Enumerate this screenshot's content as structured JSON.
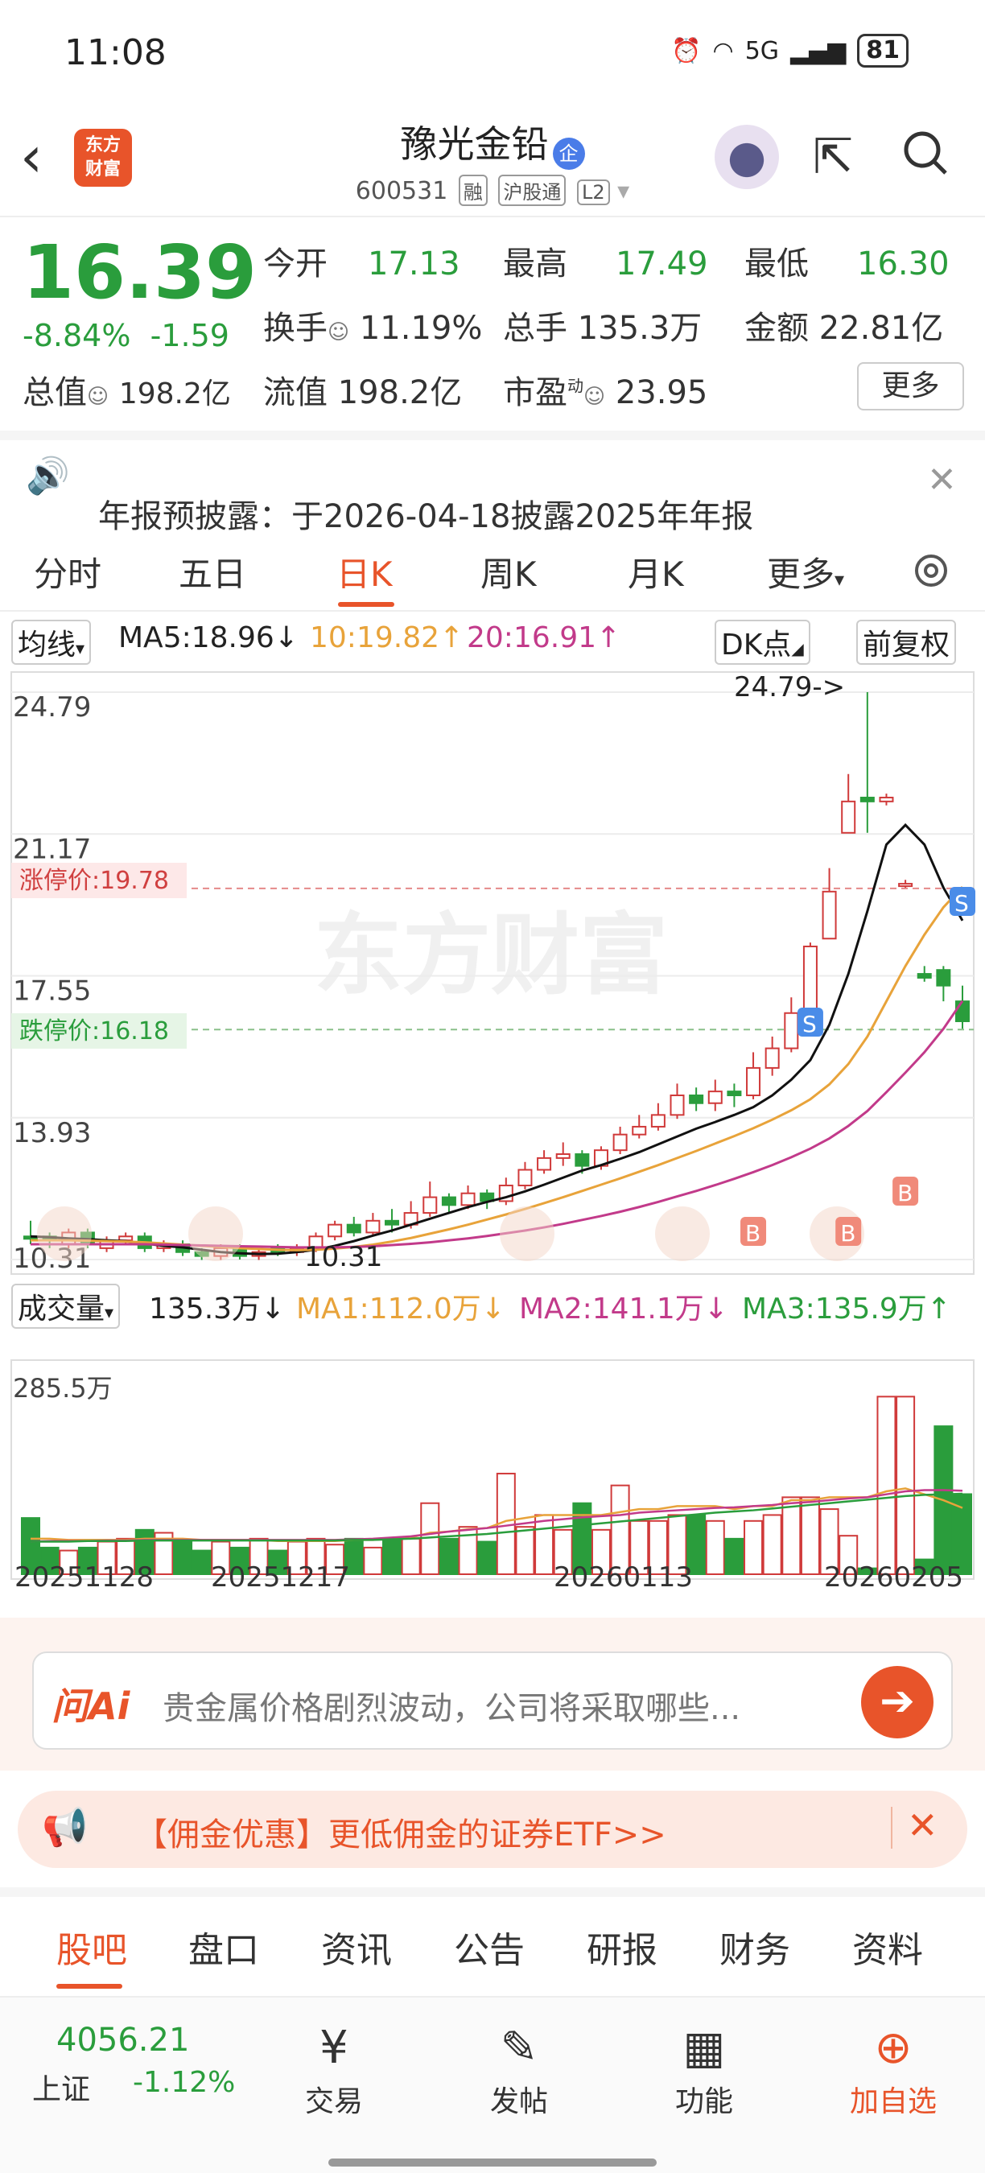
{
  "status_bar": {
    "time": "11:08",
    "battery": "81",
    "signal": "5G"
  },
  "header": {
    "name": "豫光金铅",
    "badge": "企",
    "code": "600531",
    "tags": [
      "融",
      "沪股通",
      "L2"
    ],
    "logo_text": [
      "东方",
      "财富"
    ]
  },
  "quote": {
    "price": "16.39",
    "pct": "-8.84%",
    "change": "-1.59",
    "open_label": "今开",
    "open": "17.13",
    "high_label": "最高",
    "high": "17.49",
    "low_label": "最低",
    "low": "16.30",
    "turnover_label": "换手",
    "turnover": "11.19%",
    "volume_label": "总手",
    "volume": "135.3万",
    "amount_label": "金额",
    "amount": "22.81亿",
    "mktcap_label": "总值",
    "mktcap": "198.2亿",
    "float_label": "流值",
    "float": "198.2亿",
    "pe_label": "市盈",
    "pe_sup": "动",
    "pe": "23.95",
    "more": "更多"
  },
  "notice": {
    "text": "年报预披露：于2026-04-18披露2025年年报"
  },
  "ktabs": [
    "分时",
    "五日",
    "日K",
    "周K",
    "月K",
    "更多"
  ],
  "ma": {
    "select": "均线",
    "ma5": "MA5:18.96↓",
    "ma10": "10:19.82↑",
    "ma20": "20:16.91↑",
    "dk": "DK点",
    "adjust": "前复权"
  },
  "kchart": {
    "y_labels": [
      "24.79",
      "21.17",
      "17.55",
      "13.93",
      "10.31"
    ],
    "limit_up": "涨停价:19.78",
    "limit_down": "跌停价:16.18",
    "max_note": "24.79->",
    "min_note": "10.31",
    "watermark": "东方财富",
    "signals": {
      "B": "B",
      "S": "S"
    }
  },
  "vol": {
    "select": "成交量",
    "vol": "135.3万↓",
    "ma1": "MA1:112.0万↓",
    "ma2": "MA2:141.1万↓",
    "ma3": "MA3:135.9万↑",
    "max": "285.5万"
  },
  "dates": [
    "20251128",
    "20251217",
    "20260113",
    "20260205"
  ],
  "chart_data": {
    "type": "candlestick",
    "ylim": [
      10.31,
      24.79
    ],
    "candles": [
      [
        10.9,
        10.85,
        11.3,
        10.7
      ],
      [
        10.9,
        10.8,
        11.0,
        10.6
      ],
      [
        10.7,
        11.0,
        11.1,
        10.6
      ],
      [
        11.0,
        10.7,
        11.1,
        10.6
      ],
      [
        10.6,
        10.8,
        10.9,
        10.5
      ],
      [
        10.8,
        10.9,
        11.0,
        10.7
      ],
      [
        10.9,
        10.6,
        11.0,
        10.5
      ],
      [
        10.6,
        10.7,
        10.8,
        10.5
      ],
      [
        10.7,
        10.5,
        10.8,
        10.4
      ],
      [
        10.5,
        10.4,
        10.6,
        10.3
      ],
      [
        10.4,
        10.6,
        10.7,
        10.3
      ],
      [
        10.6,
        10.4,
        10.7,
        10.31
      ],
      [
        10.4,
        10.5,
        10.6,
        10.3
      ],
      [
        10.6,
        10.5,
        10.7,
        10.4
      ],
      [
        10.5,
        10.6,
        10.7,
        10.4
      ],
      [
        10.6,
        10.9,
        11.0,
        10.5
      ],
      [
        10.9,
        11.2,
        11.3,
        10.8
      ],
      [
        11.2,
        11.0,
        11.4,
        10.9
      ],
      [
        11.0,
        11.3,
        11.5,
        10.9
      ],
      [
        11.3,
        11.2,
        11.6,
        11.0
      ],
      [
        11.2,
        11.5,
        11.8,
        11.1
      ],
      [
        11.5,
        11.9,
        12.3,
        11.4
      ],
      [
        11.9,
        11.7,
        12.0,
        11.5
      ],
      [
        11.7,
        12.0,
        12.2,
        11.6
      ],
      [
        12.0,
        11.8,
        12.1,
        11.6
      ],
      [
        11.8,
        12.2,
        12.4,
        11.7
      ],
      [
        12.2,
        12.6,
        12.8,
        12.1
      ],
      [
        12.6,
        12.9,
        13.1,
        12.5
      ],
      [
        12.9,
        13.0,
        13.3,
        12.7
      ],
      [
        13.0,
        12.7,
        13.1,
        12.5
      ],
      [
        12.7,
        13.1,
        13.2,
        12.6
      ],
      [
        13.1,
        13.5,
        13.7,
        13.0
      ],
      [
        13.5,
        13.7,
        14.0,
        13.4
      ],
      [
        13.7,
        14.0,
        14.3,
        13.6
      ],
      [
        14.0,
        14.5,
        14.8,
        13.9
      ],
      [
        14.5,
        14.3,
        14.7,
        14.1
      ],
      [
        14.3,
        14.6,
        14.9,
        14.1
      ],
      [
        14.6,
        14.5,
        14.8,
        14.2
      ],
      [
        14.5,
        15.2,
        15.6,
        14.4
      ],
      [
        15.2,
        15.7,
        16.0,
        15.0
      ],
      [
        15.7,
        16.6,
        17.0,
        15.6
      ],
      [
        16.7,
        18.3,
        18.4,
        16.6
      ],
      [
        18.5,
        19.7,
        20.3,
        18.5
      ],
      [
        21.2,
        22.0,
        22.7,
        21.2
      ],
      [
        22.1,
        22.0,
        24.79,
        21.2
      ],
      [
        22.0,
        22.1,
        22.2,
        21.9
      ],
      [
        19.9,
        19.9,
        20.0,
        19.8
      ],
      [
        17.6,
        17.5,
        17.8,
        17.4
      ],
      [
        17.7,
        17.3,
        17.8,
        16.9
      ],
      [
        16.9,
        16.39,
        17.3,
        16.2
      ]
    ],
    "ma5": [
      10.9,
      10.88,
      10.85,
      10.83,
      10.8,
      10.78,
      10.72,
      10.66,
      10.62,
      10.56,
      10.5,
      10.47,
      10.45,
      10.46,
      10.5,
      10.56,
      10.66,
      10.78,
      10.92,
      11.05,
      11.2,
      11.35,
      11.5,
      11.65,
      11.78,
      11.9,
      12.05,
      12.22,
      12.4,
      12.58,
      12.72,
      12.88,
      13.05,
      13.25,
      13.45,
      13.65,
      13.82,
      14.0,
      14.2,
      14.5,
      14.9,
      15.4,
      16.3,
      17.6,
      19.2,
      20.9,
      21.4,
      20.9,
      19.8,
      18.96
    ],
    "ma10": [
      10.8,
      10.8,
      10.8,
      10.79,
      10.78,
      10.77,
      10.75,
      10.72,
      10.69,
      10.66,
      10.63,
      10.6,
      10.58,
      10.56,
      10.55,
      10.56,
      10.59,
      10.63,
      10.69,
      10.77,
      10.86,
      10.97,
      11.08,
      11.2,
      11.33,
      11.46,
      11.6,
      11.75,
      11.9,
      12.06,
      12.22,
      12.38,
      12.55,
      12.72,
      12.9,
      13.08,
      13.27,
      13.46,
      13.66,
      13.88,
      14.12,
      14.4,
      14.78,
      15.3,
      16.0,
      16.9,
      17.8,
      18.6,
      19.3,
      19.82
    ],
    "ma20": [
      10.7,
      10.7,
      10.7,
      10.7,
      10.7,
      10.7,
      10.7,
      10.69,
      10.68,
      10.67,
      10.66,
      10.65,
      10.64,
      10.63,
      10.62,
      10.62,
      10.62,
      10.63,
      10.65,
      10.68,
      10.71,
      10.75,
      10.8,
      10.85,
      10.91,
      10.98,
      11.05,
      11.13,
      11.22,
      11.32,
      11.42,
      11.53,
      11.65,
      11.78,
      11.92,
      12.06,
      12.21,
      12.37,
      12.54,
      12.72,
      12.92,
      13.14,
      13.4,
      13.72,
      14.1,
      14.58,
      15.08,
      15.6,
      16.2,
      16.91
    ],
    "volume_max": 285.5,
    "volume": [
      95,
      45,
      40,
      45,
      55,
      60,
      75,
      70,
      55,
      40,
      55,
      45,
      60,
      40,
      55,
      60,
      50,
      60,
      45,
      60,
      60,
      120,
      60,
      80,
      55,
      170,
      80,
      100,
      75,
      120,
      75,
      150,
      90,
      90,
      100,
      100,
      90,
      60,
      90,
      100,
      130,
      130,
      110,
      65,
      10,
      300,
      300,
      25,
      250,
      135.3
    ],
    "vol_ma1": [
      60,
      60,
      58,
      58,
      58,
      58,
      60,
      60,
      60,
      58,
      58,
      58,
      58,
      56,
      56,
      56,
      56,
      58,
      58,
      60,
      62,
      70,
      72,
      76,
      78,
      90,
      95,
      100,
      100,
      100,
      100,
      105,
      110,
      110,
      115,
      115,
      115,
      110,
      115,
      115,
      125,
      125,
      130,
      130,
      130,
      140,
      145,
      135,
      125,
      112
    ],
    "vol_ma2": [
      55,
      56,
      56,
      56,
      57,
      57,
      58,
      58,
      58,
      58,
      58,
      58,
      58,
      58,
      58,
      58,
      58,
      59,
      60,
      62,
      64,
      68,
      72,
      75,
      78,
      82,
      86,
      90,
      93,
      96,
      98,
      100,
      104,
      106,
      108,
      110,
      112,
      113,
      115,
      117,
      120,
      122,
      125,
      128,
      130,
      135,
      140,
      142,
      142,
      141.1
    ],
    "vol_ma3": [
      55,
      55,
      55,
      56,
      56,
      56,
      57,
      57,
      57,
      57,
      57,
      57,
      57,
      57,
      57,
      57,
      57,
      58,
      58,
      59,
      60,
      62,
      64,
      66,
      68,
      71,
      74,
      77,
      80,
      83,
      86,
      89,
      92,
      95,
      98,
      101,
      104,
      106,
      108,
      111,
      114,
      117,
      120,
      123,
      126,
      129,
      132,
      134,
      135,
      135.9
    ]
  },
  "ai": {
    "brand": "问Ai",
    "query": "贵金属价格剧烈波动，公司将采取哪些..."
  },
  "promo": {
    "text": "【佣金优惠】更低佣金的证券ETF>>"
  },
  "btabs": [
    "股吧",
    "盘口",
    "资讯",
    "公告",
    "研报",
    "财务",
    "资料"
  ],
  "bnav": {
    "index_value": "4056.21",
    "index_name": "上证",
    "index_pct": "-1.12%",
    "items": [
      "交易",
      "发帖",
      "功能",
      "加自选"
    ]
  }
}
